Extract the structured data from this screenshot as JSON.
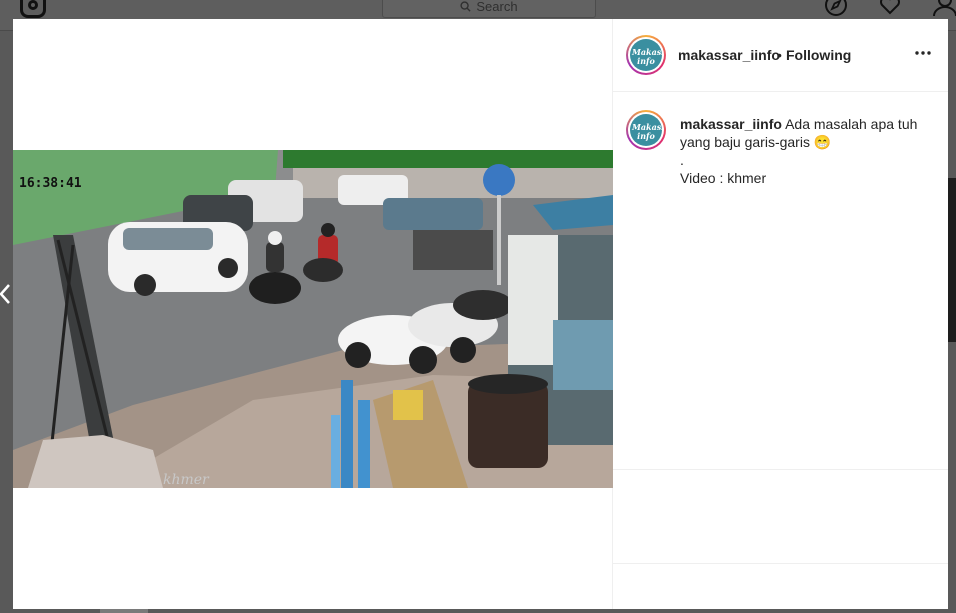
{
  "nav": {
    "search_placeholder": "Search",
    "logo_icon": "instagram-icon",
    "icons": [
      "compass-icon",
      "heart-icon",
      "profile-icon"
    ]
  },
  "post": {
    "username": "makassar_iinfo",
    "separator": "•",
    "follow_status": "Following",
    "more_icon": "more-options-icon",
    "avatar_text": "Makassar info",
    "caption": {
      "username": "makassar_iinfo",
      "line1": "Ada masalah apa tuh yang baju garis-garis",
      "emoji": "😁",
      "line2": ".",
      "line3": "Video : khmer"
    }
  },
  "video": {
    "timestamp": "16:38:41",
    "watermark": "khmer"
  },
  "colors": {
    "overlay": "#595959",
    "text": "#262626",
    "border": "#efefef"
  }
}
